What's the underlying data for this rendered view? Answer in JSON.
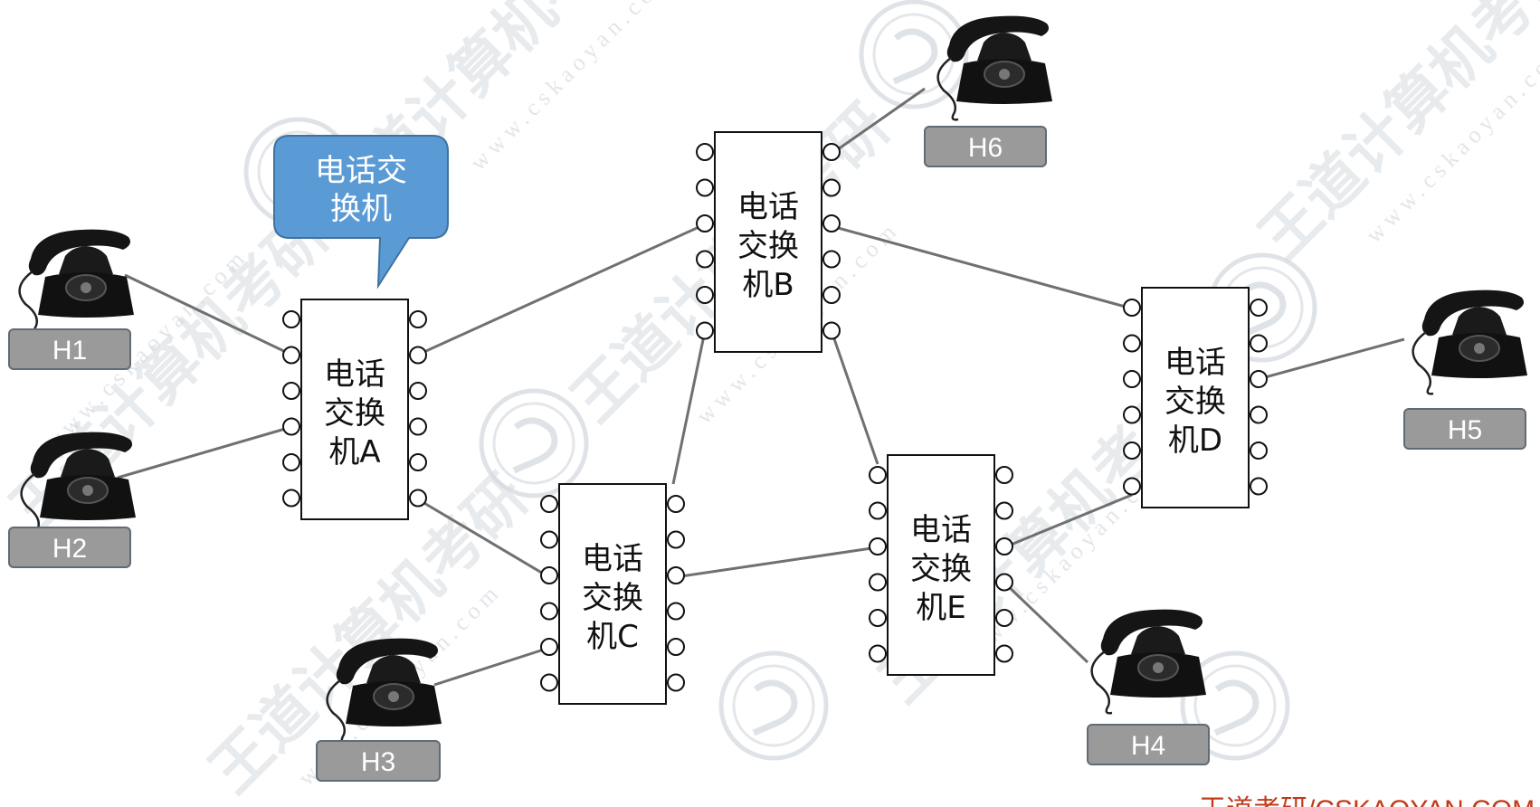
{
  "callout": {
    "lines": [
      "电话交",
      "换机"
    ]
  },
  "switches": [
    {
      "id": "A",
      "lines": [
        "电话",
        "交换",
        "机A"
      ]
    },
    {
      "id": "B",
      "lines": [
        "电话",
        "交换",
        "机B"
      ]
    },
    {
      "id": "C",
      "lines": [
        "电话",
        "交换",
        "机C"
      ]
    },
    {
      "id": "D",
      "lines": [
        "电话",
        "交换",
        "机D"
      ]
    },
    {
      "id": "E",
      "lines": [
        "电话",
        "交换",
        "机E"
      ]
    }
  ],
  "hosts": [
    {
      "id": "H1",
      "label": "H1"
    },
    {
      "id": "H2",
      "label": "H2"
    },
    {
      "id": "H3",
      "label": "H3"
    },
    {
      "id": "H4",
      "label": "H4"
    },
    {
      "id": "H5",
      "label": "H5"
    },
    {
      "id": "H6",
      "label": "H6"
    }
  ],
  "links": [
    [
      "H1",
      "A"
    ],
    [
      "H2",
      "A"
    ],
    [
      "A",
      "B"
    ],
    [
      "A",
      "C"
    ],
    [
      "B",
      "C"
    ],
    [
      "B",
      "D"
    ],
    [
      "B",
      "E"
    ],
    [
      "B",
      "H6"
    ],
    [
      "C",
      "E"
    ],
    [
      "C",
      "H3"
    ],
    [
      "E",
      "D"
    ],
    [
      "E",
      "H4"
    ],
    [
      "D",
      "H5"
    ]
  ],
  "watermark": {
    "text": "王道计算机考研",
    "url": "www.cskaoyan.com"
  },
  "footer": "王道考研/CSKAOYAN.COM",
  "colors": {
    "callout": "#5b9bd5",
    "host_box": "#9a9a9a",
    "link": "#707070",
    "footer": "#c23a1a"
  }
}
